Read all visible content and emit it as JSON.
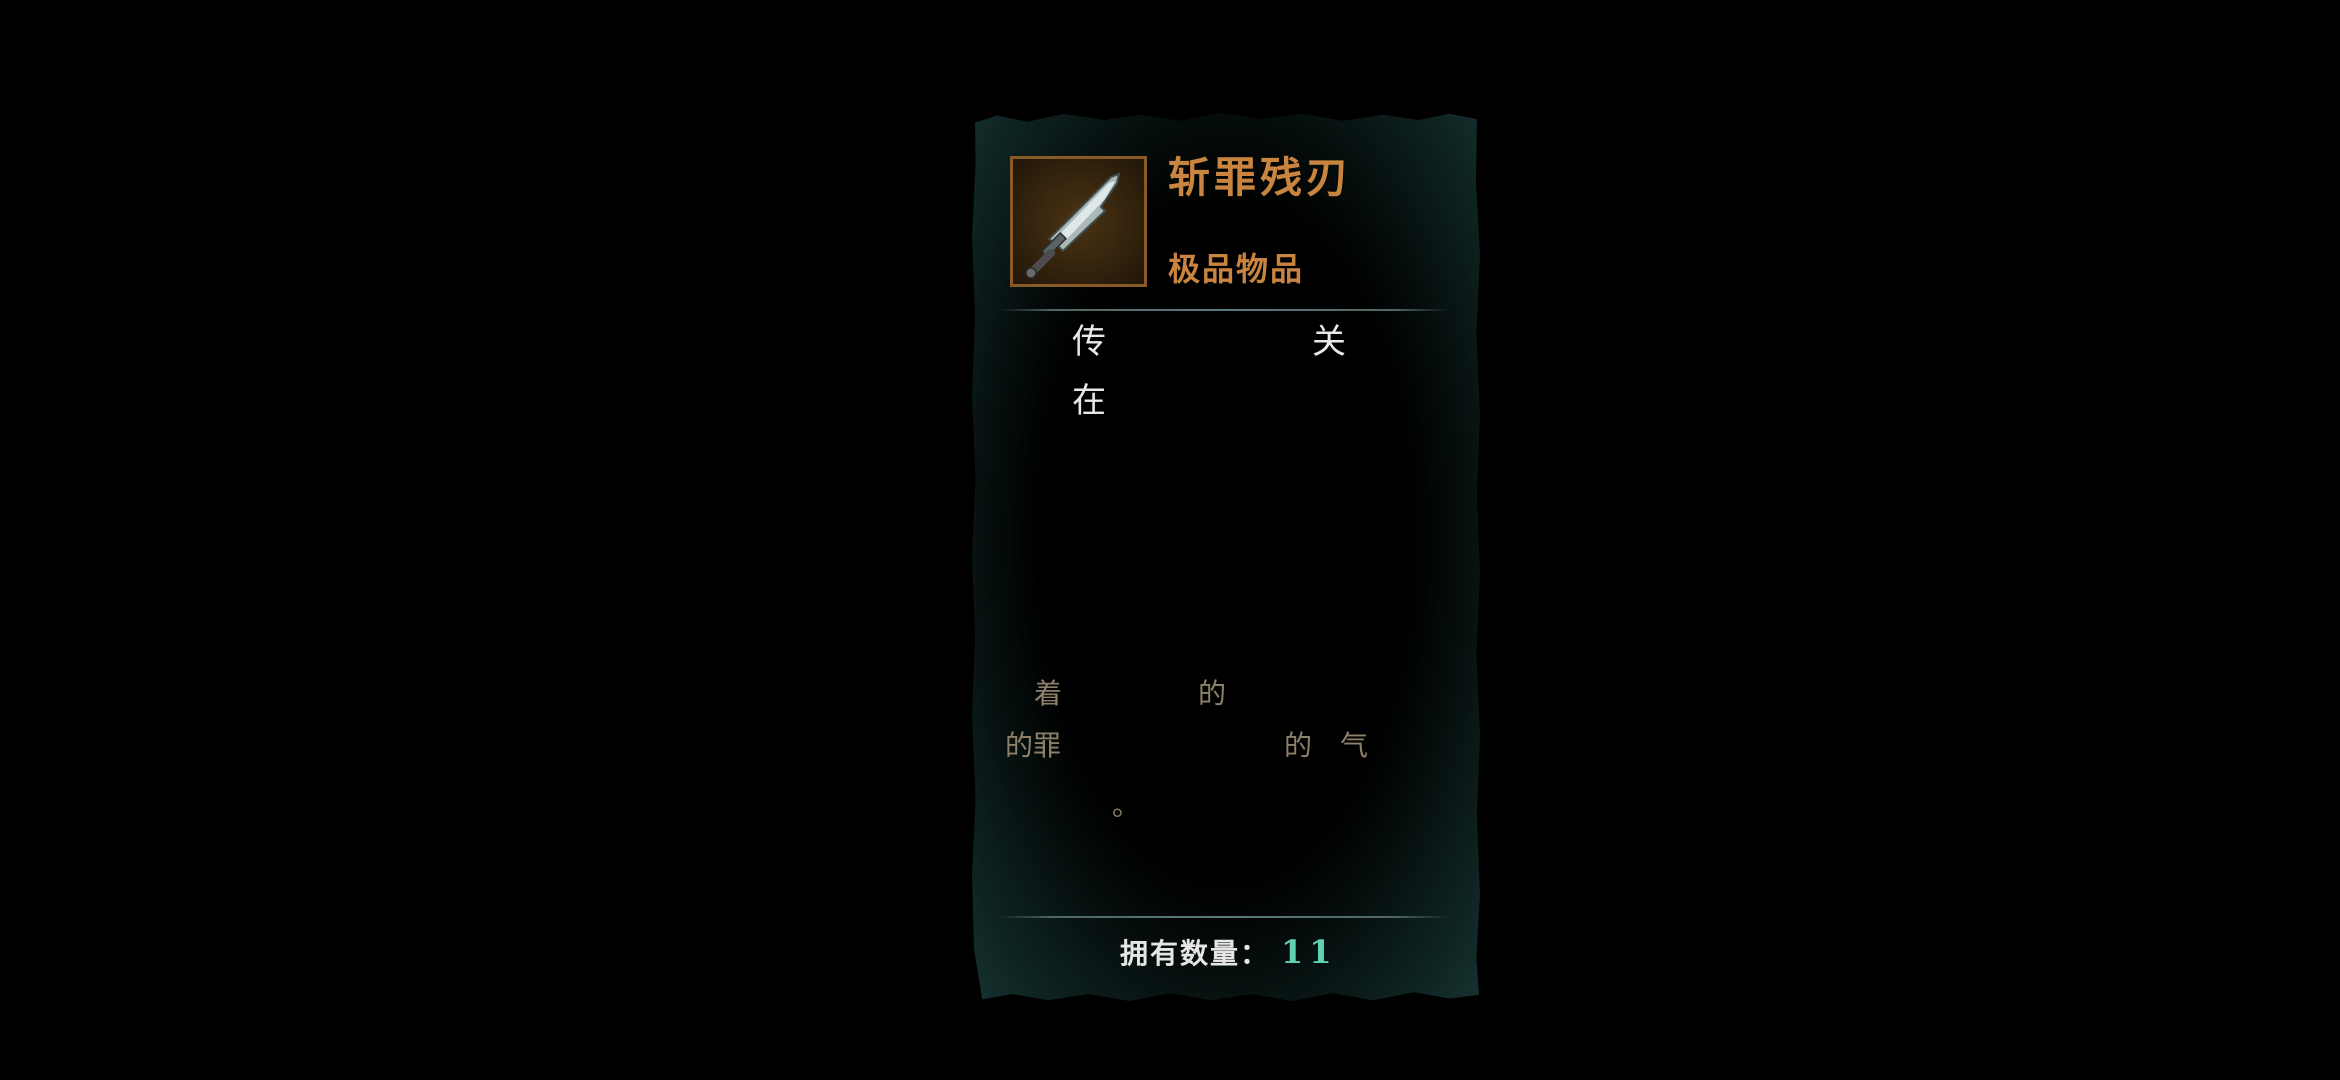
{
  "item": {
    "name": "斩罪残刃",
    "rarity": "极品物品",
    "icon": "broken-sword-icon"
  },
  "description_fragments": [
    "传",
    "关",
    "在"
  ],
  "lore_fragments": [
    "着",
    "的",
    "的罪",
    "的",
    "气",
    "。"
  ],
  "count": {
    "label": "拥有数量：",
    "value": "11"
  },
  "colors": {
    "title": "#c9853f",
    "count_value": "#5fd3b0",
    "panel_edge": "#153230"
  }
}
